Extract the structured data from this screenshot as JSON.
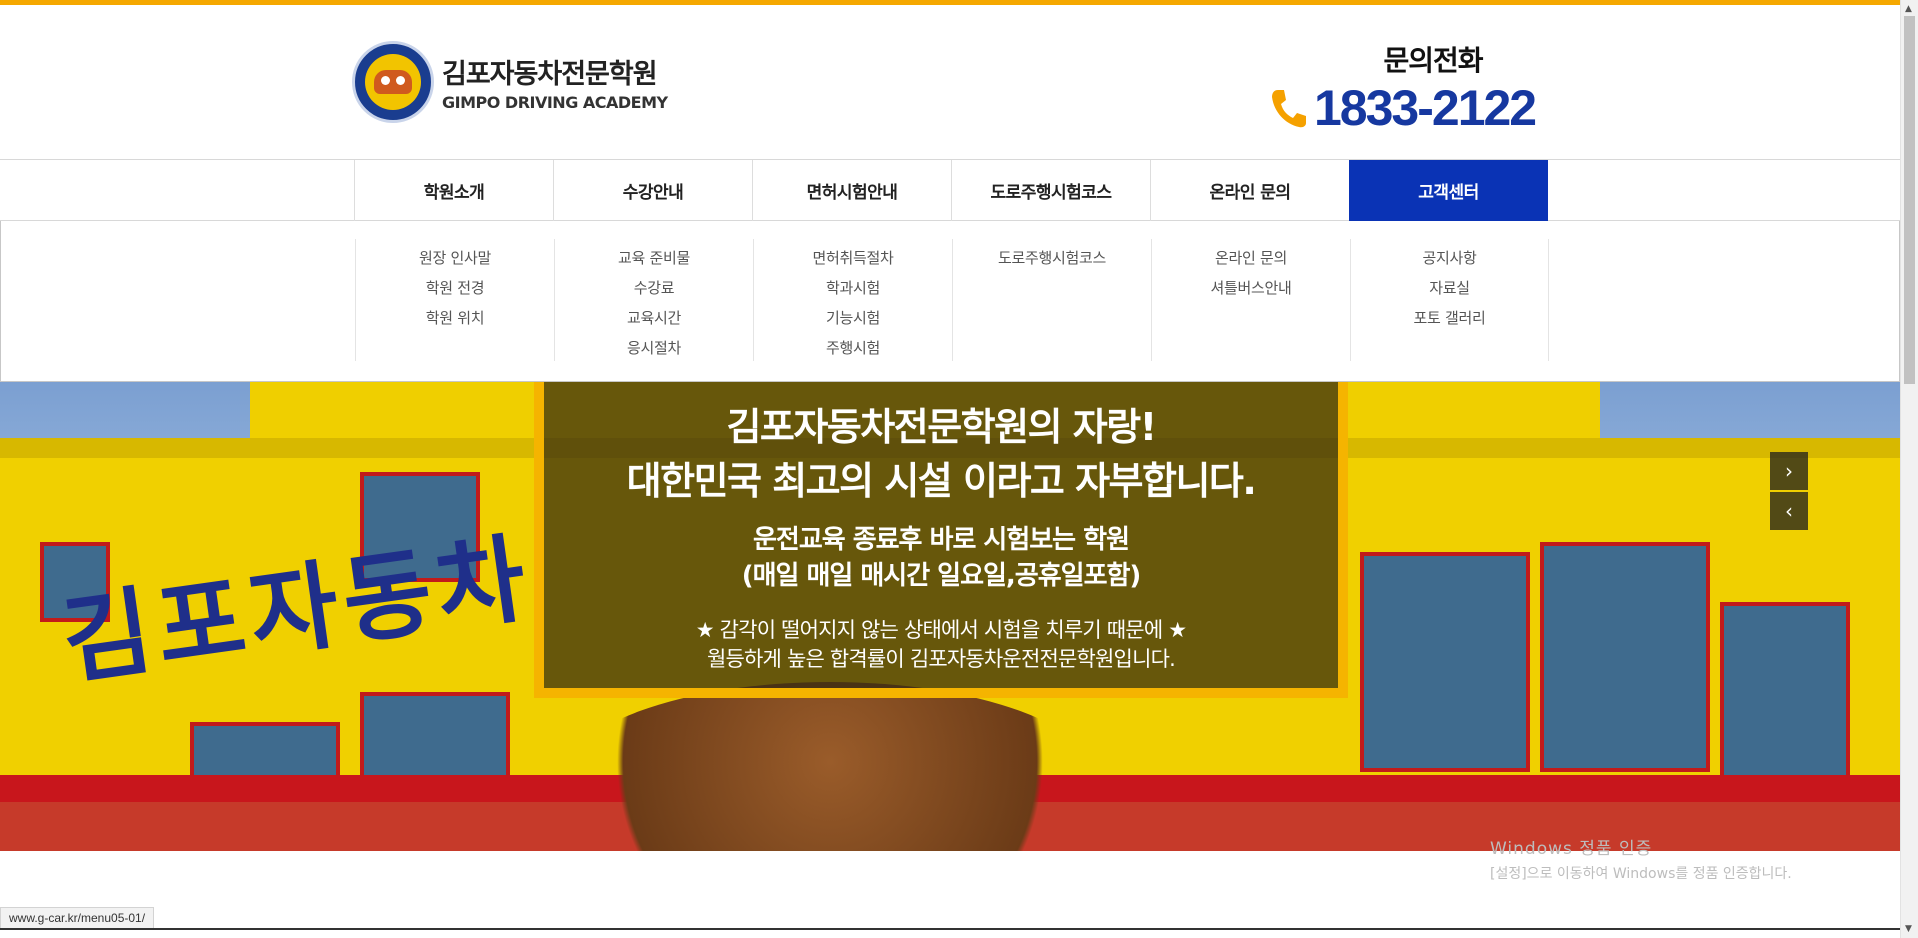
{
  "header": {
    "logo_title": "김포자동차전문학원",
    "logo_subtitle": "GIMPO DRIVING ACADEMY",
    "contact_label": "문의전화",
    "phone_number": "1833-2122"
  },
  "nav": {
    "items": [
      {
        "label": "학원소개"
      },
      {
        "label": "수강안내"
      },
      {
        "label": "면허시험안내"
      },
      {
        "label": "도로주행시험코스"
      },
      {
        "label": "온라인 문의"
      },
      {
        "label": "고객센터"
      }
    ]
  },
  "dropdown": {
    "columns": [
      [
        "원장 인사말",
        "학원 전경",
        "학원 위치"
      ],
      [
        "교육 준비물",
        "수강료",
        "교육시간",
        "응시절차"
      ],
      [
        "면허취득절차",
        "학과시험",
        "기능시험",
        "주행시험"
      ],
      [
        "도로주행시험코스"
      ],
      [
        "온라인 문의",
        "셔틀버스안내"
      ],
      [
        "공지사항",
        "자료실",
        "포토 갤러리"
      ]
    ]
  },
  "hero": {
    "headline_1": "김포자동차전문학원의 자랑!",
    "headline_2": "대한민국 최고의 시설 이라고 자부합니다.",
    "sub_1": "운전교육 종료후 바로 시험보는 학원",
    "sub_2": "(매일 매일 매시간 일요일,공휴일포함)",
    "note_1": "★ 감각이 떨어지지 않는 상태에서 시험을 치루기 때문에 ★",
    "note_2": "월등하게 높은 합격률이 김포자동차운전전문학원입니다.",
    "building_sign": "김포자동차"
  },
  "windows_watermark": {
    "line1": "Windows 정품 인증",
    "line2": "[설정]으로 이동하여 Windows를 정품 인증합니다."
  },
  "status_bar": {
    "url": "www.g-car.kr/menu05-01/"
  },
  "colors": {
    "accent": "#f5a800",
    "brand_blue": "#0a33b5",
    "phone_blue": "#1638a0"
  }
}
